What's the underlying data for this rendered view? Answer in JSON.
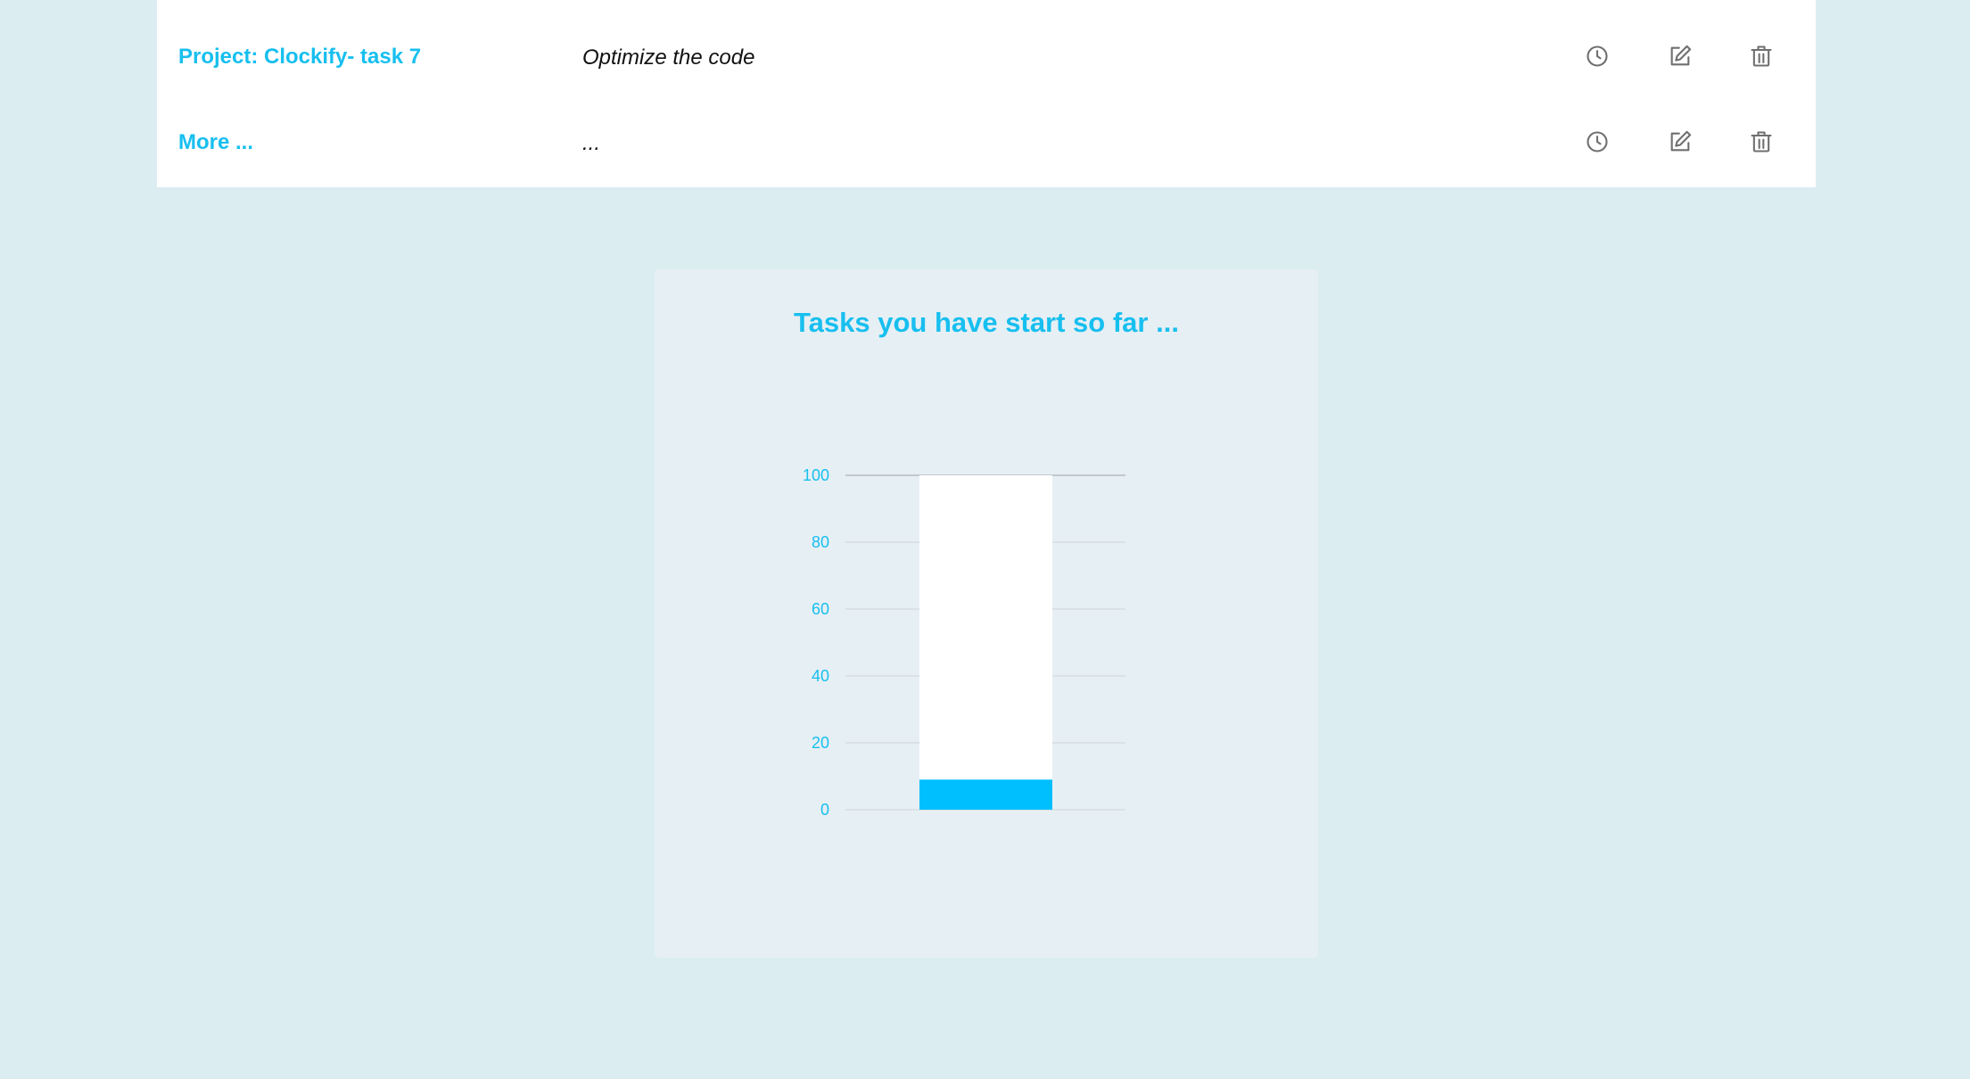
{
  "tasks": [
    {
      "project": "Project: Clockify- task 7",
      "description": "Optimize the code"
    },
    {
      "project": "More ...",
      "description": "..."
    }
  ],
  "row_icons": [
    "clock-icon",
    "edit-icon",
    "trash-icon"
  ],
  "colors": {
    "accent": "#17bfef",
    "bar_fill": "#00bfff",
    "bar_track": "#ffffff",
    "page_background": "#dbedf1",
    "card_background": "#e6eff4",
    "icon_gray": "#6f6f6f"
  },
  "chart_data": {
    "type": "bar",
    "title": "Tasks you have start so far ...",
    "categories": [
      ""
    ],
    "values": [
      9
    ],
    "track_value": 100,
    "ylim": [
      0,
      100
    ],
    "yticks": [
      0,
      20,
      40,
      60,
      80,
      100
    ],
    "grid": true
  }
}
